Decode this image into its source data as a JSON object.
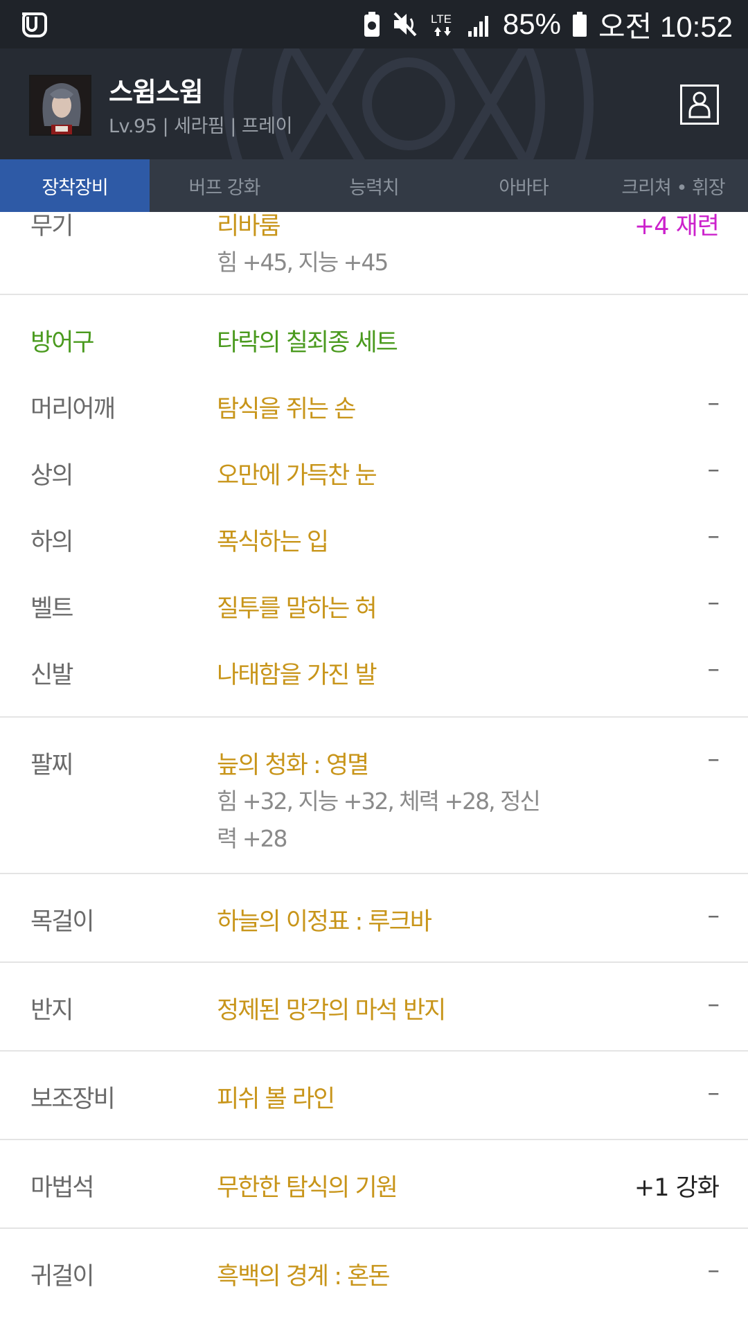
{
  "status_bar": {
    "battery": "85%",
    "time": "오전 10:52",
    "network": "LTE"
  },
  "header": {
    "name": "스윔스윔",
    "info": "Lv.95 | 세라핌 | 프레이"
  },
  "tabs": [
    {
      "label": "장착장비",
      "active": true
    },
    {
      "label": "버프 강화",
      "active": false
    },
    {
      "label": "능력치",
      "active": false
    },
    {
      "label": "아바타",
      "active": false
    },
    {
      "label": "크리쳐 • 휘장",
      "active": false
    }
  ],
  "equipment": {
    "weapon": {
      "slot": "무기",
      "name": "리바룸",
      "value": "+4 재련",
      "stats": "힘 +45, 지능 +45"
    },
    "armor_set": {
      "slot": "방어구",
      "name": "타락의 칠죄종 세트"
    },
    "armor": [
      {
        "slot": "머리어깨",
        "name": "탐식을 쥐는 손",
        "value": "–"
      },
      {
        "slot": "상의",
        "name": "오만에 가득찬 눈",
        "value": "–"
      },
      {
        "slot": "하의",
        "name": "폭식하는 입",
        "value": "–"
      },
      {
        "slot": "벨트",
        "name": "질투를 말하는 혀",
        "value": "–"
      },
      {
        "slot": "신발",
        "name": "나태함을 가진 발",
        "value": "–"
      }
    ],
    "bracelet": {
      "slot": "팔찌",
      "name": "늪의 청화 : 영멸",
      "value": "–",
      "stats": "힘 +32, 지능 +32, 체력 +28, 정신력 +28"
    },
    "necklace": {
      "slot": "목걸이",
      "name": "하늘의 이정표 : 루크바",
      "value": "–"
    },
    "ring": {
      "slot": "반지",
      "name": "정제된 망각의 마석 반지",
      "value": "–"
    },
    "sub_equip": {
      "slot": "보조장비",
      "name": "피쉬 볼 라인",
      "value": "–"
    },
    "magic_stone": {
      "slot": "마법석",
      "name": "무한한 탐식의 기원",
      "value": "+1 강화"
    },
    "earring": {
      "slot": "귀걸이",
      "name": "흑백의 경계 : 혼돈",
      "value": "–"
    }
  },
  "colors": {
    "item_gold": "#c8951a",
    "set_green": "#4a9a1e",
    "refine_magenta": "#cc22cc",
    "tab_active": "#2e5aa6"
  }
}
